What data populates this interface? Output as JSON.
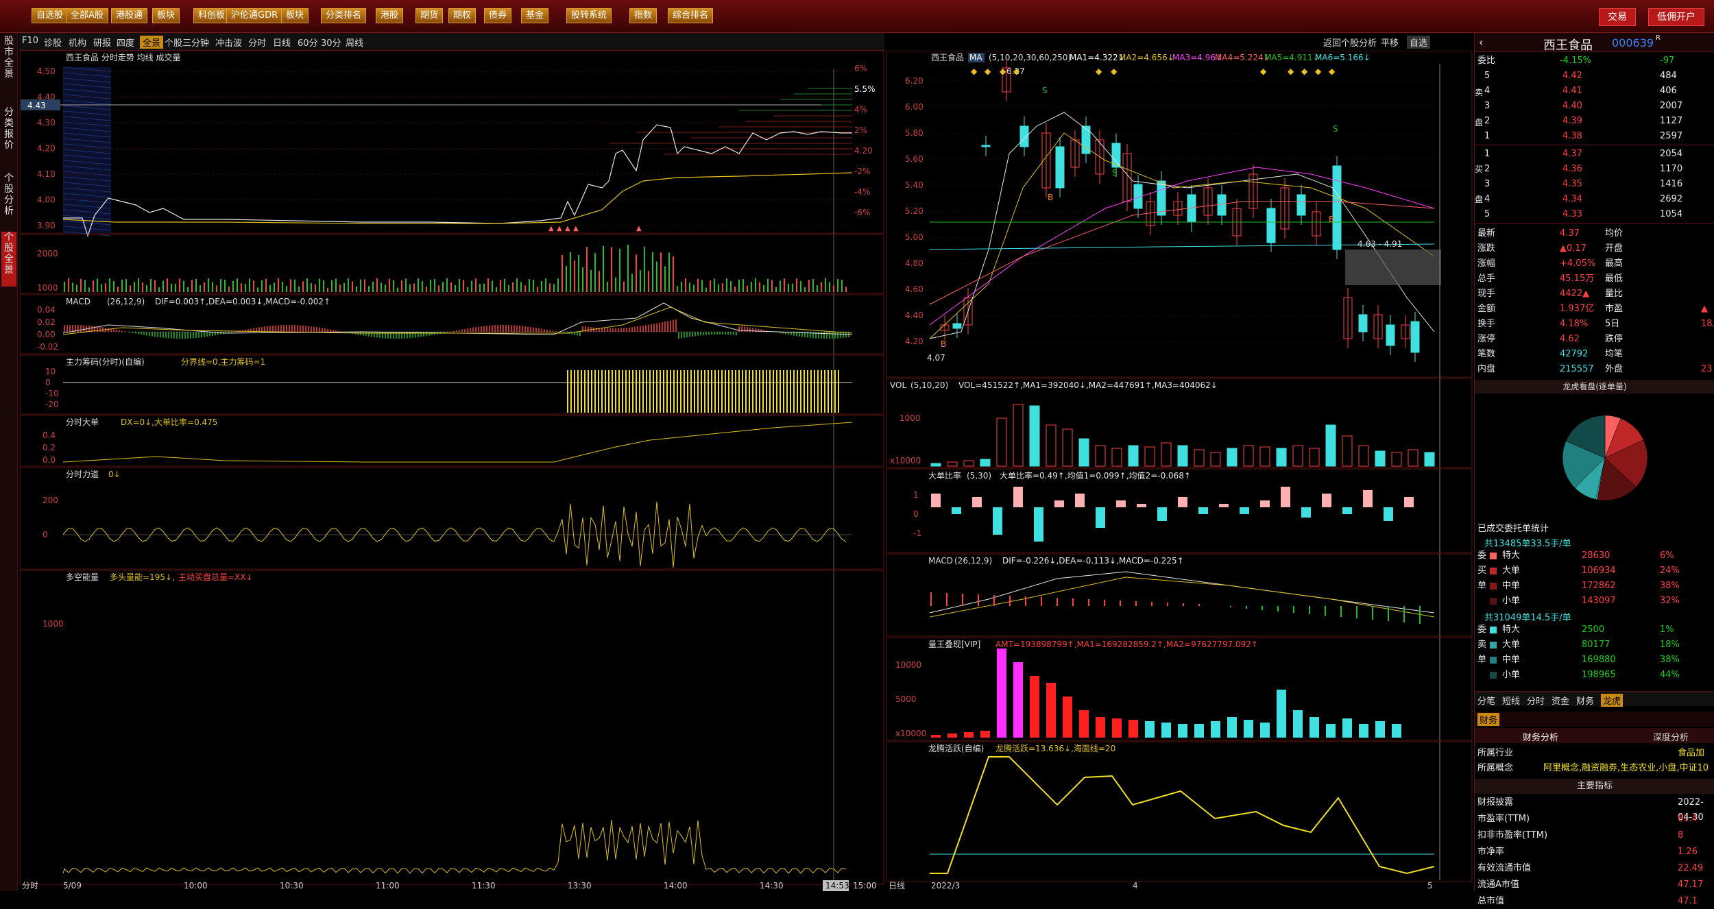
{
  "topbar": {
    "items": [
      "自选股",
      "全部A股",
      "港股通",
      "板块",
      "科创板",
      "沪伦通GDR",
      "板块",
      "分类排名",
      "港股",
      "期货",
      "期权",
      "债券",
      "基金",
      "股转系统",
      "指数",
      "综合排名"
    ],
    "trade": "交易",
    "open_account": "低佣开户"
  },
  "tabs": {
    "items": [
      "F10",
      "诊股",
      "机构",
      "研报",
      "四度",
      "全景",
      "个股三分钟",
      "冲击波",
      "分时",
      "日线",
      "60分",
      "30分",
      "周线"
    ],
    "right": [
      "返回个股分析",
      "平移",
      "自选"
    ]
  },
  "leftrail": [
    "股市全景",
    "分类报价",
    "个股分析",
    "个股全景"
  ],
  "intraday": {
    "title": "西王食品 分时走势 均线 成交量",
    "price_ticks": [
      "4.50",
      "4.40",
      "4.30",
      "4.20",
      "4.10",
      "4.00",
      "3.90"
    ],
    "pct_ticks": [
      "6%",
      "5.5%",
      "4%",
      "2%",
      "4.20",
      "-2%",
      "-4%",
      "-6%"
    ],
    "current_price": "4.43",
    "vol_ticks": [
      "2000",
      "1000"
    ],
    "macd_label": "MACD",
    "macd_params": "(26,12,9)",
    "macd_vals": "DIF=0.003↑,DEA=0.003↓,MACD=-0.002↑",
    "macd_ticks": [
      "0.04",
      "0.02",
      "0.00",
      "-0.02"
    ],
    "zlcm_label": "主力筹码(分时)(自编)",
    "zlcm_vals": "分界线=0,主力筹码=1",
    "zlcm_ticks": [
      "10",
      "0",
      "-10",
      "-20"
    ],
    "dd_label": "分时大单",
    "dd_vals": "DX=0↓,大单比率=0.475",
    "dd_ticks": [
      "0.4",
      "0.2",
      "0.0"
    ],
    "ld_label": "分时力道",
    "ld_vals": "0↓",
    "ld_ticks": [
      "200",
      "0"
    ],
    "dk_label": "多空能量",
    "dk_vals": "多头量能=195↓,",
    "dk_vals2": "主动买盘总量=XX↓",
    "dk_ticks": [
      "1000"
    ],
    "time_axis": [
      "分时",
      "5/09",
      "10:00",
      "10:30",
      "11:00",
      "11:30",
      "13:30",
      "14:00",
      "14:30",
      "14:53",
      "15:00"
    ]
  },
  "kline": {
    "title": "西王食品",
    "ma_label": "MA",
    "ma_params": "(5,10,20,30,60,250)",
    "ma_vals": {
      "ma1": "MA1=4.322↓",
      "ma2": "MA2=4.656↓",
      "ma3": "MA3=4.96↓",
      "ma4": "MA4=5.224↓",
      "ma5": "MA5=4.911↓",
      "ma6": "MA6=5.166↓"
    },
    "price_ticks": [
      "6.20",
      "6.00",
      "5.80",
      "5.60",
      "5.40",
      "5.20",
      "5.00",
      "4.80",
      "4.60",
      "4.40",
      "4.20"
    ],
    "hi_label": "6.27",
    "lo_label": "4.07",
    "band_label": "4.63 - 4.91",
    "vol_label": "VOL",
    "vol_params": "(5,10,20)",
    "vol_vals": "VOL=451522↑,MA1=392040↓,MA2=447691↑,MA3=404062↓",
    "vol_ticks": [
      "1000",
      "x10000"
    ],
    "ddbl_label": "大单比率",
    "ddbl_params": "(5,30)",
    "ddbl_vals": "大单比率=0.49↑,均值1=0.099↑,均值2=-0.068↑",
    "ddbl_ticks": [
      "1",
      "0",
      "-1"
    ],
    "macd_label": "MACD",
    "macd_params": "(26,12,9)",
    "macd_vals": "DIF=-0.226↓,DEA=-0.113↓,MACD=-0.225↑",
    "lwdx_label": "量王叠现[VIP]",
    "lwdx_vals": "AMT=193898799↑,MA1=169282859.2↑,MA2=97627797.092↑",
    "lwdx_ticks": [
      "10000",
      "5000",
      "x10000"
    ],
    "lthy_label": "龙腾活跃(自编)",
    "lthy_vals": "龙腾活跃=13.636↓,海面线=20",
    "time_axis": [
      "日线",
      "2022/3",
      "4",
      "5"
    ]
  },
  "quote": {
    "name": "西王食品",
    "code": "000639",
    "webi": {
      "label": "委比",
      "pct": "-4.15%",
      "diff": "-97"
    },
    "sells": [
      {
        "lvl": "5",
        "p": "4.42",
        "v": "484"
      },
      {
        "lvl": "4",
        "p": "4.41",
        "v": "406"
      },
      {
        "lvl": "3",
        "p": "4.40",
        "v": "2007"
      },
      {
        "lvl": "2",
        "p": "4.39",
        "v": "1127"
      },
      {
        "lvl": "1",
        "p": "4.38",
        "v": "2597"
      }
    ],
    "buys": [
      {
        "lvl": "1",
        "p": "4.37",
        "v": "2054"
      },
      {
        "lvl": "2",
        "p": "4.36",
        "v": "1170"
      },
      {
        "lvl": "3",
        "p": "4.35",
        "v": "1416"
      },
      {
        "lvl": "4",
        "p": "4.34",
        "v": "2692"
      },
      {
        "lvl": "5",
        "p": "4.33",
        "v": "1054"
      }
    ],
    "stats": [
      {
        "k1": "最新",
        "v1": "4.37",
        "k2": "均价",
        "v2": ""
      },
      {
        "k1": "涨跌",
        "v1": "▲0.17",
        "k2": "开盘",
        "v2": ""
      },
      {
        "k1": "涨幅",
        "v1": "+4.05%",
        "k2": "最高",
        "v2": ""
      },
      {
        "k1": "总手",
        "v1": "45.15万",
        "k2": "最低",
        "v2": ""
      },
      {
        "k1": "现手",
        "v1": "4422▲",
        "k2": "量比",
        "v2": ""
      },
      {
        "k1": "金额",
        "v1": "1.937亿",
        "k2": "市盈",
        "v2": "▲"
      },
      {
        "k1": "换手",
        "v1": "4.18%",
        "k2": "5日",
        "v2": "18."
      },
      {
        "k1": "涨停",
        "v1": "4.62",
        "k2": "跌停",
        "v2": ""
      },
      {
        "k1": "笔数",
        "v1": "42792",
        "k2": "均笔",
        "v2": ""
      },
      {
        "k1": "内盘",
        "v1": "215557",
        "k2": "外盘",
        "v2": "23"
      }
    ],
    "pie_title": "龙虎看盘(逐单量)",
    "order_title": "已成交委托单统计",
    "buy_total": "共13485单33.5手/单",
    "buy_rows": [
      {
        "k": "特大",
        "v": "28630",
        "p": "6%"
      },
      {
        "k": "大单",
        "v": "106934",
        "p": "24%"
      },
      {
        "k": "中单",
        "v": "172862",
        "p": "38%"
      },
      {
        "k": "小单",
        "v": "143097",
        "p": "32%"
      }
    ],
    "buy_side": [
      "委",
      "买",
      "单"
    ],
    "sell_total": "共31049单14.5手/单",
    "sell_rows": [
      {
        "k": "特大",
        "v": "2500",
        "p": "1%"
      },
      {
        "k": "大单",
        "v": "80177",
        "p": "18%"
      },
      {
        "k": "中单",
        "v": "169880",
        "p": "38%"
      },
      {
        "k": "小单",
        "v": "198965",
        "p": "44%"
      }
    ],
    "sell_side": [
      "委",
      "卖",
      "单"
    ],
    "bottom_tabs": [
      "分笔",
      "短线",
      "分时",
      "资金",
      "财务",
      "龙虎"
    ],
    "fin_tab": "财务",
    "fin_sub": [
      "财务分析",
      "深度分析"
    ],
    "fin_rows": [
      {
        "k": "所属行业",
        "v": "食品加"
      },
      {
        "k": "所属概念",
        "v": "阿里概念,融资融券,生态农业,小盘,中证10"
      }
    ],
    "key_title": "主要指标",
    "key_rows": [
      {
        "k": "财报披露",
        "v": "2022-04-30"
      },
      {
        "k": "市盈率(TTM)",
        "v": "61.4"
      },
      {
        "k": "扣非市盈率(TTM)",
        "v": "8"
      },
      {
        "k": "市净率",
        "v": "1.26"
      },
      {
        "k": "有效流通市值",
        "v": "22.49"
      },
      {
        "k": "流通A市值",
        "v": "47.17"
      },
      {
        "k": "总市值",
        "v": "47.1"
      }
    ],
    "side_labels": [
      "卖",
      "盘",
      "买",
      "盘"
    ]
  },
  "colors": {
    "up": "#ff4040",
    "down": "#40e0e0",
    "accent": "#c88a10",
    "border": "#5a1414"
  }
}
